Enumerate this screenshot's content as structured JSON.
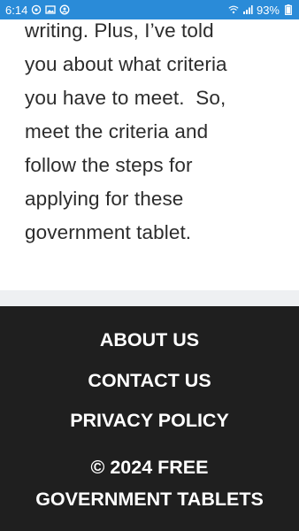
{
  "status_bar": {
    "time": "6:14",
    "battery": "93%",
    "left_icons": [
      "whatsapp-icon",
      "gallery-icon",
      "notification-icon"
    ],
    "right_icons": [
      "wifi-icon",
      "signal-icon",
      "battery-icon"
    ],
    "bg_color": "#2a8bd8"
  },
  "article": {
    "lines": [
      "writing. Plus, I’ve told",
      "you about what criteria",
      "you have to meet.  So,",
      "meet the criteria and",
      "follow the steps for",
      "applying for these",
      "government tablet."
    ]
  },
  "footer": {
    "links": [
      "ABOUT US",
      "CONTACT US",
      "PRIVACY POLICY"
    ],
    "copyright_lines": [
      "© 2024 FREE",
      "GOVERNMENT TABLETS"
    ],
    "bg_color": "#1f1f1f"
  }
}
